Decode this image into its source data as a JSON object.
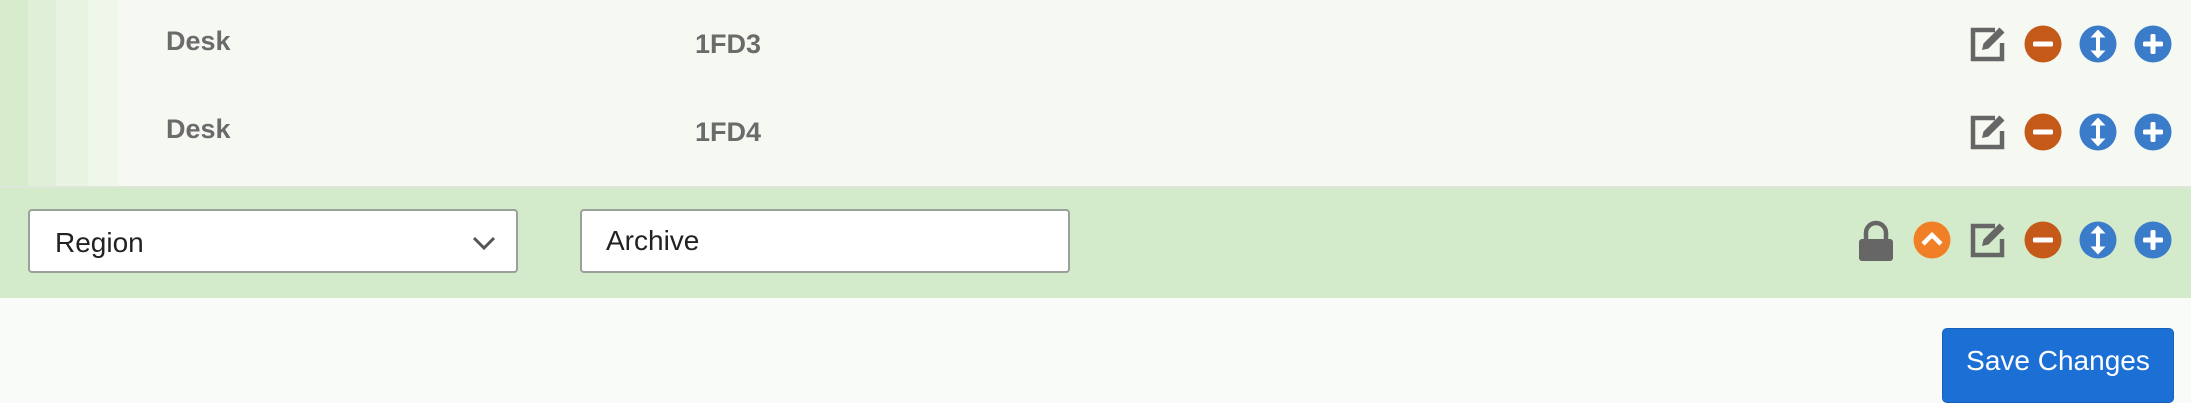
{
  "rows": [
    {
      "type": "Desk",
      "code": "1FD3"
    },
    {
      "type": "Desk",
      "code": "1FD4"
    }
  ],
  "group": {
    "select_value": "Region",
    "name_value": "Archive"
  },
  "footer": {
    "save_label": "Save Changes"
  },
  "icons": {
    "edit": "edit-icon",
    "remove": "minus-circle-icon",
    "move": "arrows-vertical-icon",
    "add": "plus-circle-icon",
    "lock": "lock-icon",
    "collapse": "chevron-up-circle-icon",
    "dropdown": "chevron-down-icon"
  },
  "colors": {
    "remove": "#c4591a",
    "move": "#3a7cc9",
    "add": "#3a7cc9",
    "collapse": "#f07f26",
    "lock": "#666666",
    "edit": "#666666",
    "save_button": "#1c6fd4",
    "group_row_bg": "#d4ebcb"
  }
}
